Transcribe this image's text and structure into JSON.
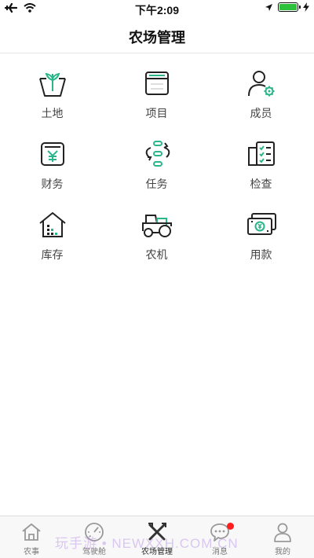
{
  "status_bar": {
    "time": "下午2:09"
  },
  "header": {
    "title": "农场管理"
  },
  "menu": [
    {
      "name": "land",
      "label": "土地",
      "icon": "sprout-icon"
    },
    {
      "name": "project",
      "label": "项目",
      "icon": "window-icon"
    },
    {
      "name": "members",
      "label": "成员",
      "icon": "user-gear-icon"
    },
    {
      "name": "finance",
      "label": "财务",
      "icon": "yuan-wallet-icon"
    },
    {
      "name": "tasks",
      "label": "任务",
      "icon": "task-cycle-icon"
    },
    {
      "name": "inspection",
      "label": "检查",
      "icon": "checklist-icon"
    },
    {
      "name": "warehouse",
      "label": "库存",
      "icon": "warehouse-icon"
    },
    {
      "name": "machinery",
      "label": "农机",
      "icon": "tractor-icon"
    },
    {
      "name": "payment",
      "label": "用款",
      "icon": "banknote-icon"
    }
  ],
  "tabbar": [
    {
      "label": "农事",
      "icon": "house-icon",
      "active": false
    },
    {
      "label": "驾驶舱",
      "icon": "gauge-icon",
      "active": false
    },
    {
      "label": "农场管理",
      "icon": "tools-icon",
      "active": true
    },
    {
      "label": "消息",
      "icon": "message-icon",
      "active": false,
      "badge": true
    },
    {
      "label": "我的",
      "icon": "person-icon",
      "active": false
    }
  ],
  "watermark": "玩手游 • NEWXXH.COM.CN",
  "colors": {
    "accent": "#2bb58a",
    "icon_stroke": "#222222",
    "badge": "#ff1d1d"
  }
}
